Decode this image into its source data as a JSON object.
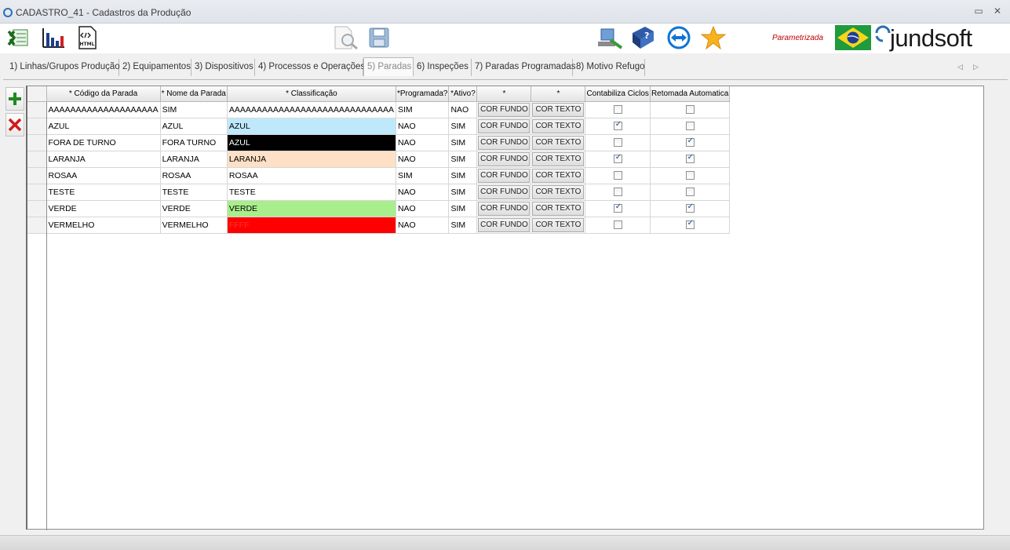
{
  "window": {
    "title": "CADASTRO_41 - Cadastros da Produção"
  },
  "toolbar": {
    "left_icons": [
      "excel-icon",
      "chart-icon",
      "html-export-icon"
    ],
    "center_icons": [
      "print-preview-icon",
      "save-icon"
    ],
    "right_icons": [
      "login-icon",
      "help-book-icon",
      "teamviewer-icon",
      "favorite-star-icon"
    ],
    "status_label": "Parametrizada",
    "brand": "jundsoft",
    "flag_icon": "brazil-flag-icon"
  },
  "tabs": [
    {
      "label": "1) Linhas/Grupos Produção",
      "active": false
    },
    {
      "label": "2) Equipamentos",
      "active": false
    },
    {
      "label": "3) Dispositivos",
      "active": false
    },
    {
      "label": "4) Processos e Operações",
      "active": false
    },
    {
      "label": "5) Paradas",
      "active": true
    },
    {
      "label": "6) Inspeções",
      "active": false
    },
    {
      "label": "7) Paradas Programadas",
      "active": false
    },
    {
      "label": "8) Motivo Refugo",
      "active": false
    }
  ],
  "side_buttons": {
    "add": "add-icon",
    "delete": "delete-icon"
  },
  "grid": {
    "columns": [
      "* Código da Parada",
      "* Nome da Parada",
      "* Classificação",
      "*Programada?",
      "*Ativo?",
      "*",
      "*",
      "Contabiliza Ciclos",
      "Retomada Automatica"
    ],
    "bg_button_label": "COR FUNDO",
    "text_button_label": "COR TEXTO",
    "rows": [
      {
        "codigo": "AAAAAAAAAAAAAAAAAAAA",
        "nome": "SIM",
        "classificacao": "AAAAAAAAAAAAAAAAAAAAAAAAAAAAAA",
        "bg": "#ffffff",
        "fg": "#000000",
        "programada": "SIM",
        "ativo": "NAO",
        "contabiliza": false,
        "retomada": false
      },
      {
        "codigo": "AZUL",
        "nome": "AZUL",
        "classificacao": "AZUL",
        "bg": "#bfe9fb",
        "fg": "#000000",
        "programada": "NAO",
        "ativo": "SIM",
        "contabiliza": true,
        "retomada": false
      },
      {
        "codigo": "FORA DE TURNO",
        "nome": "FORA TURNO",
        "classificacao": "AZUL",
        "bg": "#000000",
        "fg": "#ffffff",
        "programada": "NAO",
        "ativo": "SIM",
        "contabiliza": false,
        "retomada": true
      },
      {
        "codigo": "LARANJA",
        "nome": "LARANJA",
        "classificacao": "LARANJA",
        "bg": "#fde0c6",
        "fg": "#000000",
        "programada": "NAO",
        "ativo": "SIM",
        "contabiliza": true,
        "retomada": true
      },
      {
        "codigo": "ROSAA",
        "nome": "ROSAA",
        "classificacao": "ROSAA",
        "bg": "#ffffff",
        "fg": "#000000",
        "programada": "SIM",
        "ativo": "SIM",
        "contabiliza": false,
        "retomada": false
      },
      {
        "codigo": "TESTE",
        "nome": "TESTE",
        "classificacao": "TESTE",
        "bg": "#ffffff",
        "fg": "#000000",
        "programada": "NAO",
        "ativo": "SIM",
        "contabiliza": false,
        "retomada": false
      },
      {
        "codigo": "VERDE",
        "nome": "VERDE",
        "classificacao": "VERDE",
        "bg": "#a8ee8c",
        "fg": "#000000",
        "programada": "NAO",
        "ativo": "SIM",
        "contabiliza": true,
        "retomada": true
      },
      {
        "codigo": "VERMELHO",
        "nome": "VERMELHO",
        "classificacao": "FFFF",
        "bg": "#ff0000",
        "fg": "#ff3030",
        "programada": "NAO",
        "ativo": "SIM",
        "contabiliza": false,
        "retomada": true
      }
    ]
  }
}
